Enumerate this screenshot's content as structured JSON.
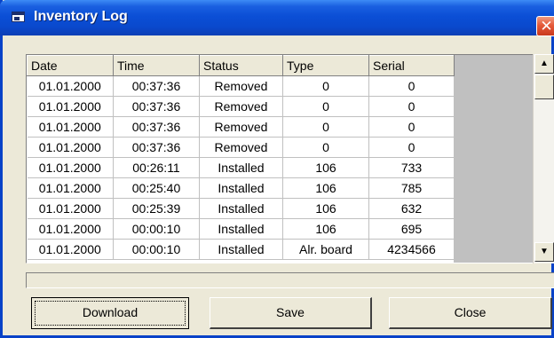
{
  "window": {
    "title": "Inventory Log",
    "close_glyph": "✕"
  },
  "table": {
    "columns": [
      "Date",
      "Time",
      "Status",
      "Type",
      "Serial"
    ],
    "rows": [
      [
        "01.01.2000",
        "00:37:36",
        "Removed",
        "0",
        "0"
      ],
      [
        "01.01.2000",
        "00:37:36",
        "Removed",
        "0",
        "0"
      ],
      [
        "01.01.2000",
        "00:37:36",
        "Removed",
        "0",
        "0"
      ],
      [
        "01.01.2000",
        "00:37:36",
        "Removed",
        "0",
        "0"
      ],
      [
        "01.01.2000",
        "00:26:11",
        "Installed",
        "106",
        "733"
      ],
      [
        "01.01.2000",
        "00:25:40",
        "Installed",
        "106",
        "785"
      ],
      [
        "01.01.2000",
        "00:25:39",
        "Installed",
        "106",
        "632"
      ],
      [
        "01.01.2000",
        "00:00:10",
        "Installed",
        "106",
        "695"
      ],
      [
        "01.01.2000",
        "00:00:10",
        "Installed",
        "Alr. board",
        "4234566"
      ]
    ]
  },
  "scrollbar": {
    "up_glyph": "▲",
    "down_glyph": "▼"
  },
  "buttons": {
    "download": "Download",
    "save": "Save",
    "close": "Close"
  },
  "colors": {
    "titlebar": "#0b4fd6",
    "window_face": "#ece9d8",
    "close_button": "#e55a3a",
    "table_empty_area": "#c0c0c0"
  },
  "icons": {
    "title": "window-app-icon",
    "close": "close-icon",
    "scroll_up": "scroll-up-arrow-icon",
    "scroll_down": "scroll-down-arrow-icon"
  }
}
